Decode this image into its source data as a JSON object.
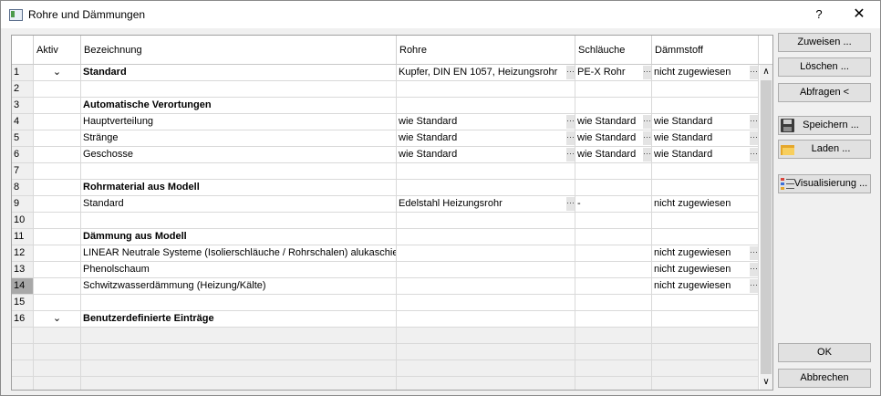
{
  "window": {
    "title": "Rohre und Dämmungen",
    "help": "?",
    "close": "✕"
  },
  "grid": {
    "headers": {
      "aktiv": "Aktiv",
      "bez": "Bezeichnung",
      "rohre": "Rohre",
      "schl": "Schläuche",
      "daemm": "Dämmstoff"
    },
    "rows": [
      {
        "n": "1",
        "aktiv": "⌄",
        "bez": "Standard",
        "rohre": "Kupfer, DIN EN 1057, Heizungsrohr",
        "schl": "PE-X Rohr",
        "daemm": "nicht zugewiesen"
      },
      {
        "n": "2",
        "aktiv": "",
        "bez": "",
        "rohre": "",
        "schl": "",
        "daemm": ""
      },
      {
        "n": "3",
        "aktiv": "",
        "bez": "Automatische Verortungen",
        "rohre": "",
        "schl": "",
        "daemm": ""
      },
      {
        "n": "4",
        "aktiv": "",
        "bez": "Hauptverteilung",
        "rohre": "wie Standard",
        "schl": "wie Standard",
        "daemm": "wie Standard"
      },
      {
        "n": "5",
        "aktiv": "",
        "bez": "Stränge",
        "rohre": "wie Standard",
        "schl": "wie Standard",
        "daemm": "wie Standard"
      },
      {
        "n": "6",
        "aktiv": "",
        "bez": "Geschosse",
        "rohre": "wie Standard",
        "schl": "wie Standard",
        "daemm": "wie Standard"
      },
      {
        "n": "7",
        "aktiv": "",
        "bez": "",
        "rohre": "",
        "schl": "",
        "daemm": ""
      },
      {
        "n": "8",
        "aktiv": "",
        "bez": "Rohrmaterial aus Modell",
        "rohre": "",
        "schl": "",
        "daemm": ""
      },
      {
        "n": "9",
        "aktiv": "",
        "bez": "Standard",
        "rohre": "Edelstahl Heizungsrohr",
        "schl": "-",
        "daemm": "nicht zugewiesen"
      },
      {
        "n": "10",
        "aktiv": "",
        "bez": "",
        "rohre": "",
        "schl": "",
        "daemm": ""
      },
      {
        "n": "11",
        "aktiv": "",
        "bez": "Dämmung aus Modell",
        "rohre": "",
        "schl": "",
        "daemm": ""
      },
      {
        "n": "12",
        "aktiv": "",
        "bez": "LINEAR Neutrale Systeme (Isolierschläuche / Rohrschalen) alukaschiert",
        "rohre": "",
        "schl": "",
        "daemm": "nicht zugewiesen"
      },
      {
        "n": "13",
        "aktiv": "",
        "bez": "Phenolschaum",
        "rohre": "",
        "schl": "",
        "daemm": "nicht zugewiesen"
      },
      {
        "n": "14",
        "aktiv": "",
        "bez": "Schwitzwasserdämmung (Heizung/Kälte)",
        "rohre": "",
        "schl": "",
        "daemm": "nicht zugewiesen"
      },
      {
        "n": "15",
        "aktiv": "",
        "bez": "",
        "rohre": "",
        "schl": "",
        "daemm": ""
      },
      {
        "n": "16",
        "aktiv": "⌄",
        "bez": "Benutzerdefinierte Einträge",
        "rohre": "",
        "schl": "",
        "daemm": ""
      }
    ],
    "scroll_up": "∧",
    "scroll_down": "∨"
  },
  "buttons": {
    "zuweisen": "Zuweisen ...",
    "loeschen": "Löschen ...",
    "abfragen": "Abfragen <",
    "speichern": "Speichern ...",
    "laden": "Laden ...",
    "visualisierung": "Visualisierung ...",
    "ok": "OK",
    "abbrechen": "Abbrechen"
  }
}
